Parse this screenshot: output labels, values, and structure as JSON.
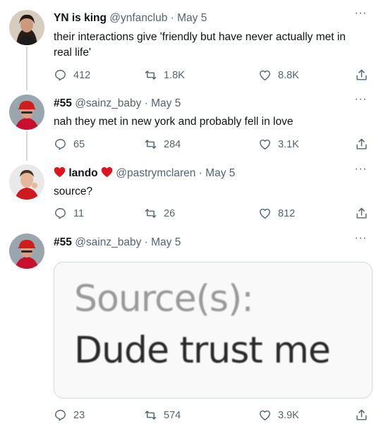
{
  "tweets": [
    {
      "name": "YN is king",
      "handle": "@ynfanclub",
      "separator": "·",
      "date": "May 5",
      "text_line1": "their interactions give 'friendly but have never actually met in",
      "text_line2": "real life'",
      "replies": "412",
      "retweets": "1.8K",
      "likes": "8.8K"
    },
    {
      "name": "#55",
      "handle": "@sainz_baby",
      "separator": "·",
      "date": "May 5",
      "text_line1": "nah they met in new york and probably fell in love",
      "replies": "65",
      "retweets": "284",
      "likes": "3.1K"
    },
    {
      "name": "lando",
      "handle": "@pastrymclaren",
      "separator": "·",
      "date": "May 5",
      "text_line1": "source?",
      "replies": "11",
      "retweets": "26",
      "likes": "812"
    },
    {
      "name": "#55",
      "handle": "@sainz_baby",
      "separator": "·",
      "date": "May 5",
      "image_line1": "Source(s):",
      "image_line2": "Dude trust me",
      "replies": "23",
      "retweets": "574",
      "likes": "3.9K"
    }
  ],
  "more_label": "···",
  "colors": {
    "text": "#0f1419",
    "muted": "#536471",
    "line": "#cfd9de",
    "heart_emoji": "#e0131f"
  },
  "icons": [
    "reply-icon",
    "retweet-icon",
    "like-icon",
    "share-icon",
    "more-icon",
    "heart-emoji"
  ]
}
